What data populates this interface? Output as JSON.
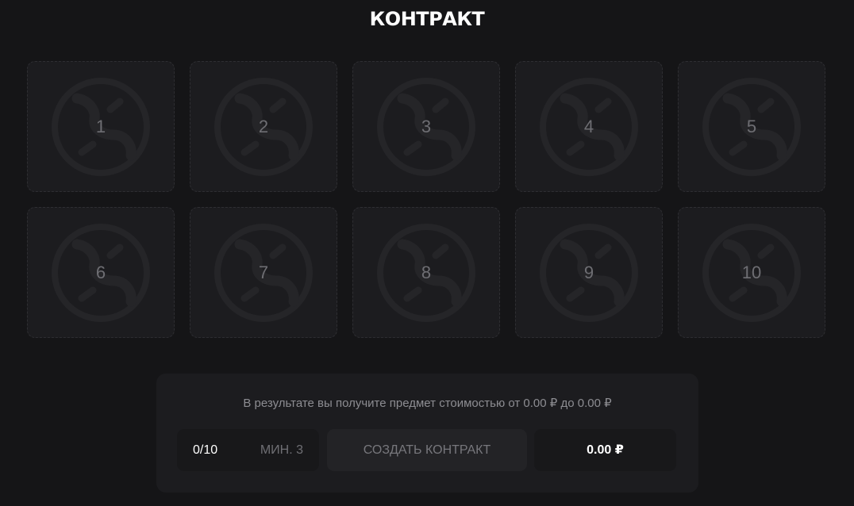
{
  "header": {
    "title": "КОНТРАКТ"
  },
  "slots": [
    "1",
    "2",
    "3",
    "4",
    "5",
    "6",
    "7",
    "8",
    "9",
    "10"
  ],
  "panel": {
    "result_text": "В результате вы получите предмет стоимостью от 0.00 ₽ до 0.00 ₽",
    "count": "0/10",
    "min_label": "МИН. 3",
    "create_label": "СОЗДАТЬ КОНТРАКТ",
    "price": "0.00 ₽"
  },
  "icons": {
    "slot_emblem": "empty-slot-emblem-icon"
  },
  "colors": {
    "background": "#151517",
    "slot_bg": "#1c1c1f",
    "emblem": "#252528",
    "text_white": "#ffffff",
    "text_muted": "#8d8d92"
  }
}
